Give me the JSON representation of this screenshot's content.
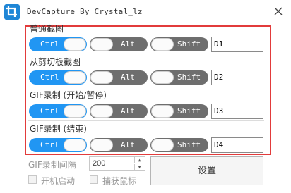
{
  "window": {
    "title": "DevCapture By Crystal_lz",
    "icon": "crop-icon",
    "accent": "#1f86d6"
  },
  "highlight_color": "#e23b3b",
  "sections": [
    {
      "label": "普通截图",
      "ctrl": "Ctrl",
      "alt": "Alt",
      "shift": "Shift",
      "key": "D1",
      "ctrl_on": true,
      "alt_on": false,
      "shift_on": false
    },
    {
      "label": "从剪切板截图",
      "ctrl": "Ctrl",
      "alt": "Alt",
      "shift": "Shift",
      "key": "D2",
      "ctrl_on": true,
      "alt_on": false,
      "shift_on": false
    },
    {
      "label": "GIF录制 (开始/暂停)",
      "ctrl": "Ctrl",
      "alt": "Alt",
      "shift": "Shift",
      "key": "D3",
      "ctrl_on": true,
      "alt_on": false,
      "shift_on": false
    },
    {
      "label": "GIF录制 (结束)",
      "ctrl": "Ctrl",
      "alt": "Alt",
      "shift": "Shift",
      "key": "D4",
      "ctrl_on": true,
      "alt_on": false,
      "shift_on": false
    }
  ],
  "colors": {
    "toggle_on": "#2196f3",
    "toggle_off": "#6e6e6e"
  },
  "footer": {
    "interval_label": "GIF录制间隔",
    "interval_value": "200",
    "settings_button": "设置",
    "autostart_label": "开机启动",
    "capture_cursor_label": "捕获鼠标"
  }
}
